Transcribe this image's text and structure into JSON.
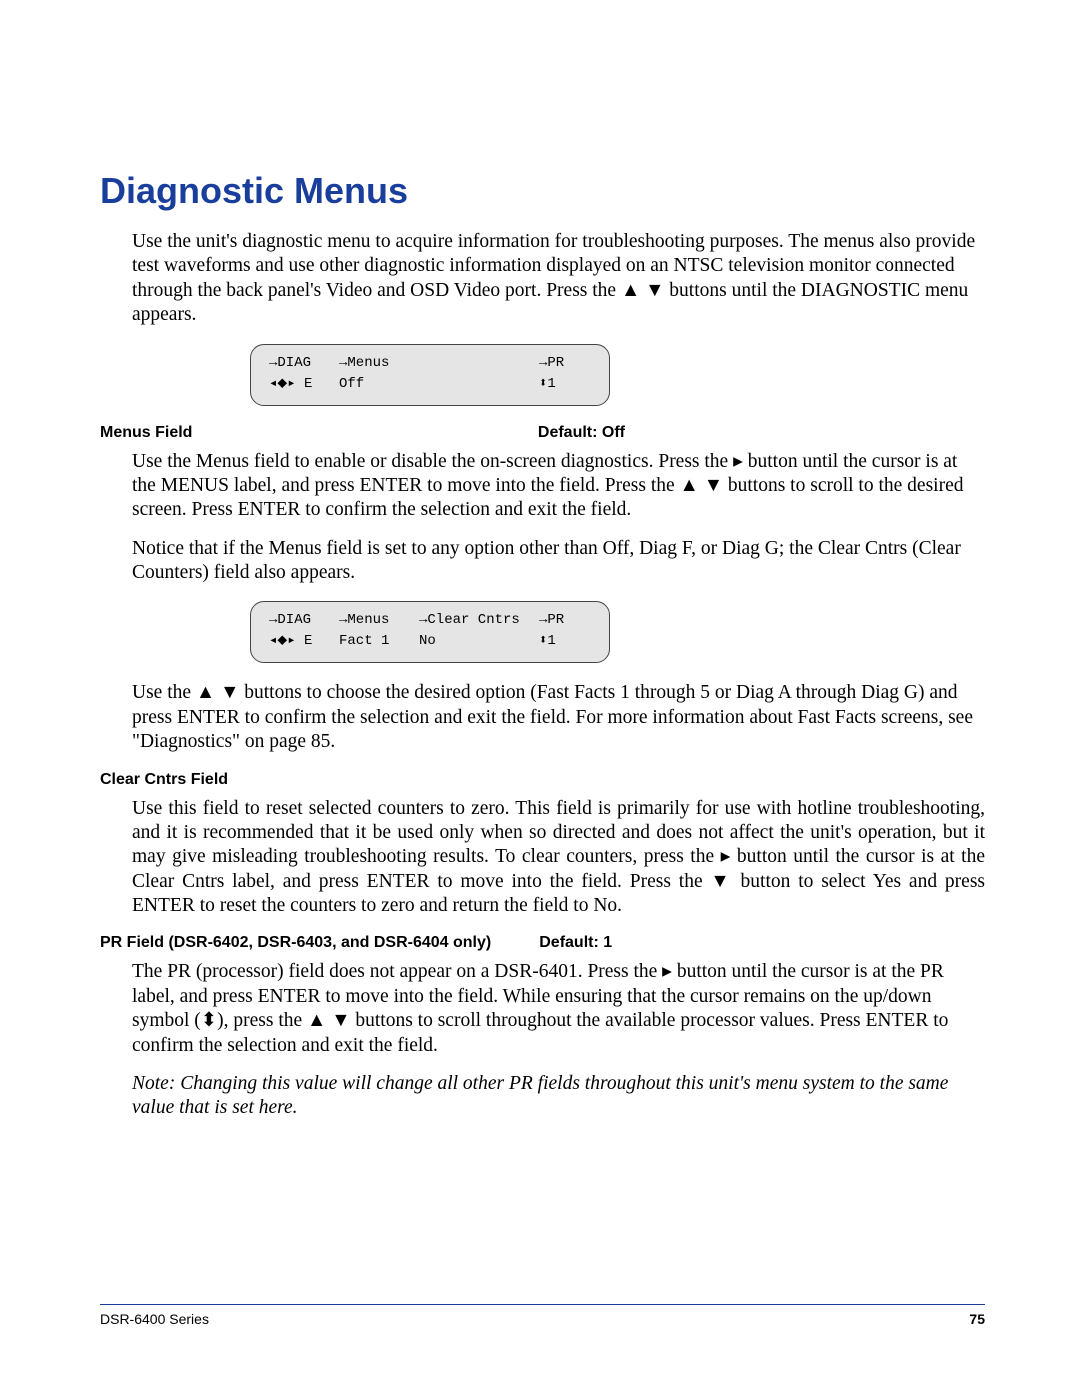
{
  "title": "Diagnostic Menus",
  "intro": "Use the unit's diagnostic menu to acquire information for troubleshooting purposes. The menus also provide test waveforms and use other diagnostic information displayed on an NTSC television monitor connected through the back panel's Video and OSD Video port. Press the ▲ ▼ buttons until the DIAGNOSTIC menu appears.",
  "lcd1": {
    "r1c1": "→DIAG",
    "r1c2": "→Menus",
    "r1c4": "→PR",
    "r2c1": "◂⬥▸ E",
    "r2c2": "Off",
    "r2c4": "⬍1"
  },
  "menus_field": {
    "label": "Menus Field",
    "default": "Default: Off",
    "p1": "Use the Menus field to enable or disable the on-screen diagnostics. Press the ▸ button until the cursor is at the MENUS label, and press ENTER to move into the field. Press the ▲ ▼ buttons to scroll to the desired screen. Press ENTER to confirm the selection and exit the field.",
    "p2": "Notice that if the Menus field is set to any option other than Off, Diag F, or Diag G; the Clear Cntrs (Clear Counters) field also appears."
  },
  "lcd2": {
    "r1c1": "→DIAG",
    "r1c2": "→Menus",
    "r1c3": "→Clear Cntrs",
    "r1c4": "→PR",
    "r2c1": "◂⬥▸ E",
    "r2c2": "Fact 1",
    "r2c3": "No",
    "r2c4": "⬍1"
  },
  "after_lcd2": "Use the ▲ ▼ buttons to choose the desired option (Fast Facts 1 through 5 or Diag A through Diag G) and press ENTER to confirm the selection and exit the field. For more information about Fast Facts screens, see \"Diagnostics\" on page 85.",
  "clear_cntrs": {
    "label": "Clear Cntrs Field",
    "p1": "Use this field to reset selected counters to zero. This field is primarily for use with hotline troubleshooting, and it is recommended that it be used only when so directed and does not affect the unit's operation, but it may give misleading troubleshooting results. To clear counters, press the ▸ button until the cursor is at the Clear Cntrs label, and press ENTER to move into the field. Press the ▼ button to select Yes and press ENTER to reset the counters to zero and return the field to No."
  },
  "pr_field": {
    "label": "PR Field (DSR-6402, DSR-6403, and DSR-6404 only)",
    "default": "Default: 1",
    "p1": "The PR (processor) field does not appear on a DSR-6401. Press the ▸ button until the cursor is at the PR label, and press ENTER to move into the field. While ensuring that the cursor remains on the up/down symbol (⬍), press the ▲ ▼ buttons to scroll throughout the available processor values. Press ENTER to confirm the selection and exit the field.",
    "note": "Note:  Changing this value will change all other PR fields throughout this unit's menu system to the same value that is set here."
  },
  "footer": {
    "series": "DSR-6400 Series",
    "page": "75"
  }
}
